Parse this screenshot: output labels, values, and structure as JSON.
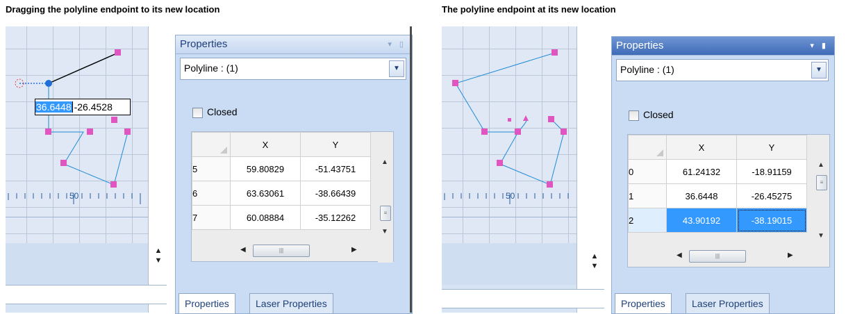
{
  "captions": {
    "left": "Dragging the polyline endpoint to its new location",
    "right": "The polyline endpoint at its new location"
  },
  "colors": {
    "vertex": "#e055c0",
    "line": "#1f8ad8",
    "selection": "#3399ff"
  },
  "left": {
    "ruler_label": "50",
    "edit_x": "36.6448",
    "edit_y": "-26.4528",
    "properties": {
      "title": "Properties",
      "object": "Polyline : (1)",
      "closed_label": "Closed",
      "closed_checked": false,
      "col_x": "X",
      "col_y": "Y",
      "rows": [
        {
          "idx": "5",
          "x": "59.80829",
          "y": "-51.43751"
        },
        {
          "idx": "6",
          "x": "63.63061",
          "y": "-38.66439"
        },
        {
          "idx": "7",
          "x": "60.08884",
          "y": "-35.12262"
        }
      ],
      "tab_properties": "Properties",
      "tab_laser": "Laser Properties"
    }
  },
  "right": {
    "ruler_label": "50",
    "properties": {
      "title": "Properties",
      "object": "Polyline : (1)",
      "closed_label": "Closed",
      "closed_checked": false,
      "col_x": "X",
      "col_y": "Y",
      "rows": [
        {
          "idx": "0",
          "x": "61.24132",
          "y": "-18.91159"
        },
        {
          "idx": "1",
          "x": "36.6448",
          "y": "-26.45275"
        },
        {
          "idx": "2",
          "x": "43.90192",
          "y": "-38.19015"
        }
      ],
      "selected_row": 2,
      "tab_properties": "Properties",
      "tab_laser": "Laser Properties"
    }
  }
}
